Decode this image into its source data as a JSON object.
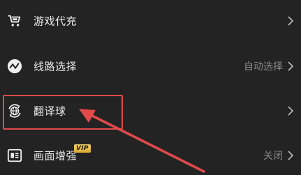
{
  "menu": {
    "items": [
      {
        "label": "游戏代充",
        "icon": "cart-icon",
        "value": ""
      },
      {
        "label": "线路选择",
        "icon": "route-icon",
        "value": "自动选择"
      },
      {
        "label": "翻译球",
        "icon": "globe-refresh-icon",
        "value": ""
      },
      {
        "label": "画面增强",
        "icon": "screen-icon",
        "value": "关闭",
        "badge": "VIP"
      }
    ]
  },
  "annotation": {
    "color": "#e24a4a"
  }
}
